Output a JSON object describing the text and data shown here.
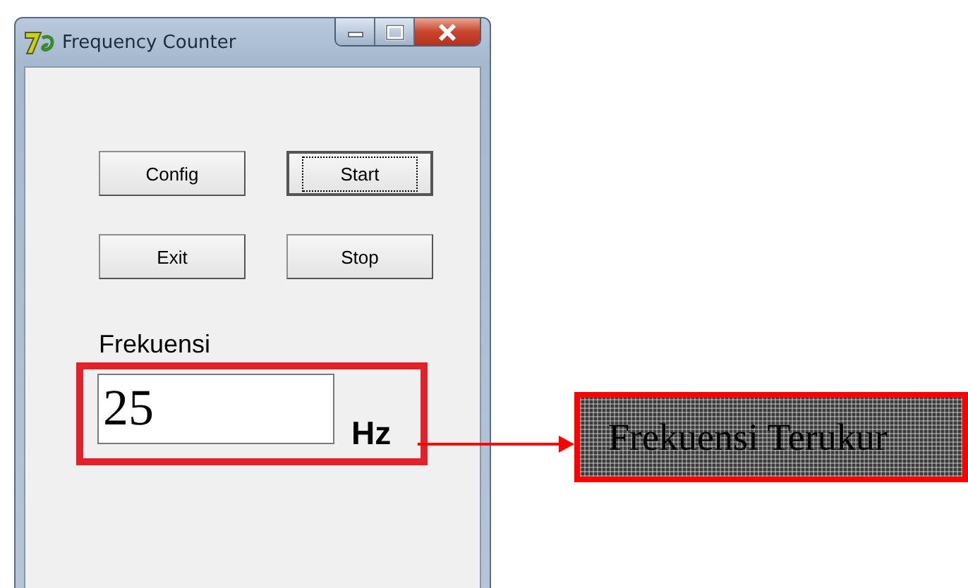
{
  "window": {
    "title": "Frequency Counter"
  },
  "buttons": [
    {
      "label": "Config",
      "focused": false
    },
    {
      "label": "Start",
      "focused": true
    },
    {
      "label": "Exit",
      "focused": false
    },
    {
      "label": "Stop",
      "focused": false
    }
  ],
  "frequency": {
    "label": "Frekuensi",
    "value": "25",
    "unit": "Hz"
  },
  "annotation": {
    "label": "Frekuensi Terukur"
  }
}
